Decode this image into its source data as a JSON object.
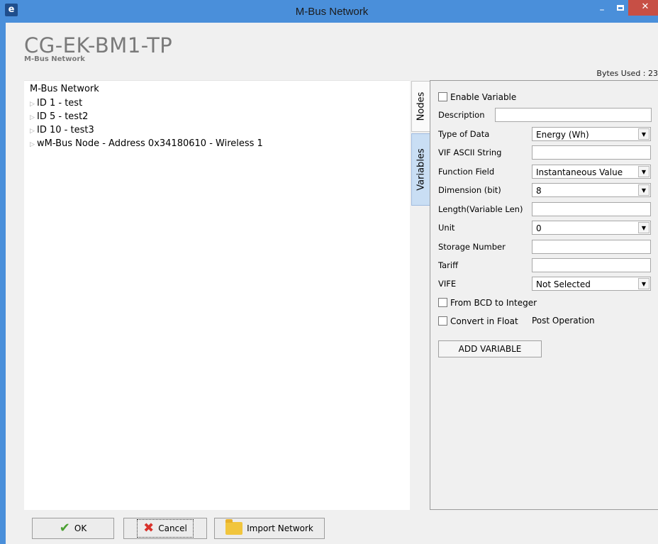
{
  "window": {
    "icon": "e",
    "title": "M-Bus Network",
    "minimize": "–",
    "close": "✕"
  },
  "header": {
    "title": "CG-EK-BM1-TP",
    "subtitle": "M-Bus Network",
    "bytes_used": "Bytes Used : 23"
  },
  "tree": {
    "root": "M-Bus Network",
    "items": [
      "ID 1 - test",
      "ID 5 - test2",
      "ID 10 - test3",
      "wM-Bus Node - Address 0x34180610 - Wireless 1"
    ]
  },
  "tabs": {
    "nodes": "Nodes",
    "variables": "Variables",
    "active": "Variables"
  },
  "form": {
    "enable_variable": "Enable Variable",
    "description_label": "Description",
    "description_value": "",
    "type_of_data_label": "Type of Data",
    "type_of_data_value": "Energy (Wh)",
    "vif_ascii_label": "VIF ASCII String",
    "vif_ascii_value": "",
    "function_field_label": "Function Field",
    "function_field_value": "Instantaneous Value",
    "dimension_label": "Dimension (bit)",
    "dimension_value": "8",
    "length_label": "Length(Variable Len)",
    "length_value": "",
    "unit_label": "Unit",
    "unit_value": "0",
    "storage_label": "Storage Number",
    "storage_value": "",
    "tariff_label": "Tariff",
    "tariff_value": "",
    "vife_label": "VIFE",
    "vife_value": "Not Selected",
    "bcd_label": "From BCD to Integer",
    "float_label": "Convert in Float",
    "post_operation": "Post Operation",
    "add_button": "ADD VARIABLE"
  },
  "footer": {
    "ok": "OK",
    "cancel": "Cancel",
    "import": "Import Network"
  }
}
